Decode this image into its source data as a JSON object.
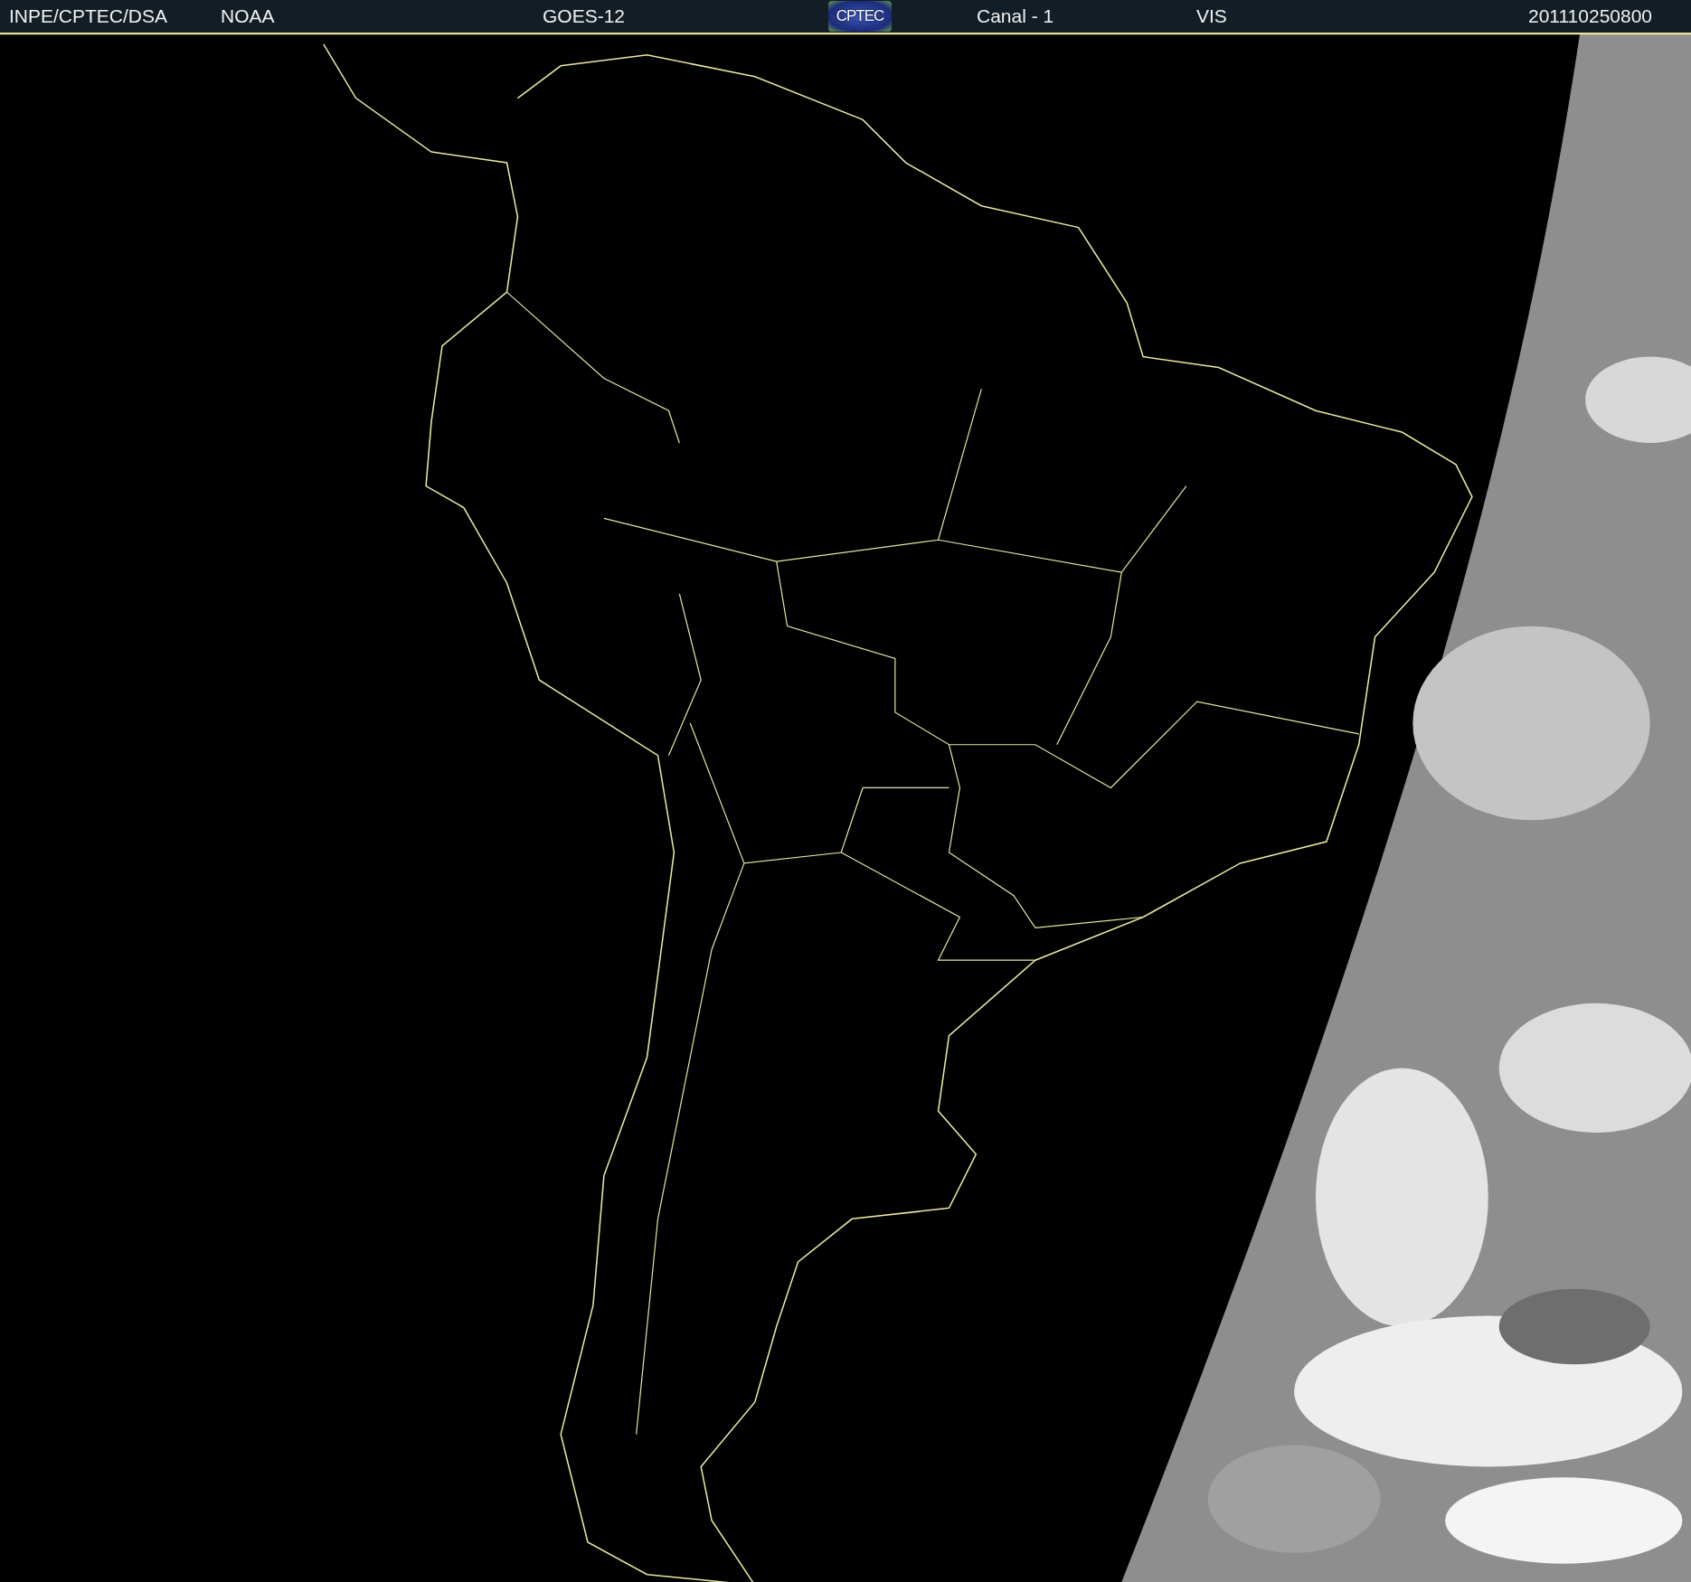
{
  "header": {
    "items": [
      {
        "kind": "text",
        "text": "INPE/CPTEC/DSA"
      },
      {
        "kind": "text",
        "text": "NOAA"
      },
      {
        "kind": "text",
        "text": "GOES-12"
      },
      {
        "kind": "logo",
        "text": "CPTEC"
      },
      {
        "kind": "text",
        "text": "Canal - 1"
      },
      {
        "kind": "text",
        "text": "VIS"
      },
      {
        "kind": "text",
        "text": "201110250800"
      }
    ]
  }
}
